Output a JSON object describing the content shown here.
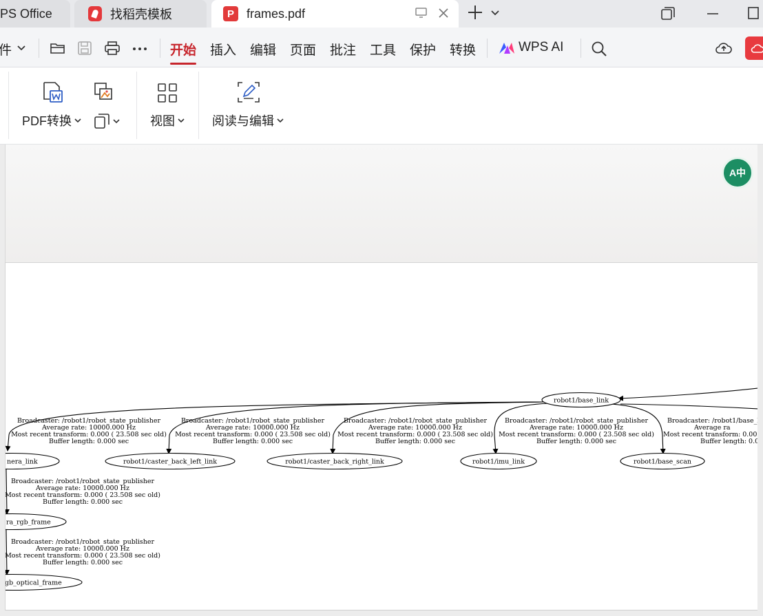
{
  "tabs": [
    {
      "label": "PS Office"
    },
    {
      "label": "找稻壳模板"
    },
    {
      "label": "frames.pdf"
    }
  ],
  "pdf_logo_letter": "P",
  "menu": {
    "file_label": "件",
    "tabs": [
      {
        "label": "开始"
      },
      {
        "label": "插入"
      },
      {
        "label": "编辑"
      },
      {
        "label": "页面"
      },
      {
        "label": "批注"
      },
      {
        "label": "工具"
      },
      {
        "label": "保护"
      },
      {
        "label": "转换"
      }
    ],
    "ai_label": "WPS AI"
  },
  "ribbon": {
    "pdf_convert": "PDF转换",
    "view": "视图",
    "read_edit": "阅读与编辑"
  },
  "translate_label": "A中",
  "graph": {
    "nodes": {
      "base_link": "robot1/base_link",
      "camera_link": "nera_link",
      "caster_left": "robot1/caster_back_left_link",
      "caster_right": "robot1/caster_back_right_link",
      "imu": "robot1/imu_link",
      "base_scan": "robot1/base_scan",
      "rgb_frame": "ra_rgb_frame",
      "optical_frame": "gb_optical_frame"
    },
    "edge_labels": {
      "camera": [
        "Broadcaster: /robot1/robot_state_publisher",
        "Average rate: 10000.000 Hz",
        "Most recent transform: 0.000 ( 23.508 sec old)",
        "Buffer length: 0.000 sec"
      ],
      "caster_left": [
        "Broadcaster: /robot1/robot_state_publisher",
        "Average rate: 10000.000 Hz",
        "Most recent transform: 0.000 ( 23.508 sec old)",
        "Buffer length: 0.000 sec"
      ],
      "caster_right": [
        "Broadcaster: /robot1/robot_state_publisher",
        "Average rate: 10000.000 Hz",
        "Most recent transform: 0.000 ( 23.508 sec old)",
        "Buffer length: 0.000 sec"
      ],
      "imu": [
        "Broadcaster: /robot1/robot_state_publisher",
        "Average rate: 10000.000 Hz",
        "Most recent transform: 0.000 ( 23.508 sec old)",
        "Buffer length: 0.000 sec"
      ],
      "base_scan": [
        "Broadcaster: /robot1/base_l",
        "Average ra",
        "Most recent transform: 0.00",
        "Buffer length: 0.0"
      ],
      "rgb_frame": [
        "Broadcaster: /robot1/robot_state_publisher",
        "Average rate: 10000.000 Hz",
        "Most recent transform: 0.000 ( 23.508 sec old)",
        "Buffer length: 0.000 sec"
      ],
      "optical": [
        "Broadcaster: /robot1/robot_state_publisher",
        "Average rate: 10000.000 Hz",
        "Most recent transform: 0.000 ( 23.508 sec old)",
        "Buffer length: 0.000 sec"
      ]
    }
  },
  "colors": {
    "accent_red": "#c7252c",
    "translate_green": "#1c8e63",
    "tabbar_bg": "#e8e9ec"
  }
}
